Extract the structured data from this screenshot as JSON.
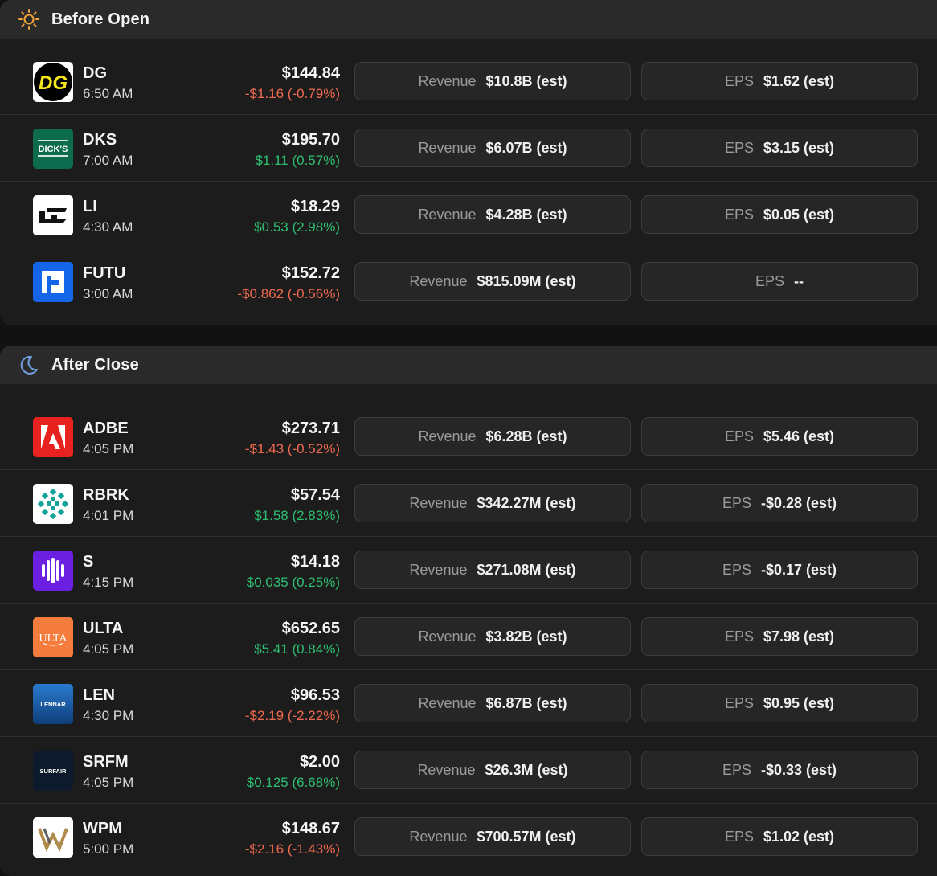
{
  "before_open": {
    "title": "Before Open",
    "icon": "sun-icon",
    "rows": [
      {
        "ticker": "DG",
        "time": "6:50 AM",
        "price": "$144.84",
        "change": "-$1.16 (-0.79%)",
        "direction": "neg",
        "revenue_label": "Revenue",
        "revenue": "$10.8B (est)",
        "eps_label": "EPS",
        "eps": "$1.62 (est)",
        "logo": "DG"
      },
      {
        "ticker": "DKS",
        "time": "7:00 AM",
        "price": "$195.70",
        "change": "$1.11 (0.57%)",
        "direction": "pos",
        "revenue_label": "Revenue",
        "revenue": "$6.07B (est)",
        "eps_label": "EPS",
        "eps": "$3.15 (est)",
        "logo": "DICK'S"
      },
      {
        "ticker": "LI",
        "time": "4:30 AM",
        "price": "$18.29",
        "change": "$0.53 (2.98%)",
        "direction": "pos",
        "revenue_label": "Revenue",
        "revenue": "$4.28B (est)",
        "eps_label": "EPS",
        "eps": "$0.05 (est)",
        "logo": ""
      },
      {
        "ticker": "FUTU",
        "time": "3:00 AM",
        "price": "$152.72",
        "change": "-$0.862 (-0.56%)",
        "direction": "neg",
        "revenue_label": "Revenue",
        "revenue": "$815.09M (est)",
        "eps_label": "EPS",
        "eps": "--",
        "logo": ""
      }
    ]
  },
  "after_close": {
    "title": "After Close",
    "icon": "moon-icon",
    "rows": [
      {
        "ticker": "ADBE",
        "time": "4:05 PM",
        "price": "$273.71",
        "change": "-$1.43 (-0.52%)",
        "direction": "neg",
        "revenue_label": "Revenue",
        "revenue": "$6.28B (est)",
        "eps_label": "EPS",
        "eps": "$5.46 (est)",
        "logo": ""
      },
      {
        "ticker": "RBRK",
        "time": "4:01 PM",
        "price": "$57.54",
        "change": "$1.58 (2.83%)",
        "direction": "pos",
        "revenue_label": "Revenue",
        "revenue": "$342.27M (est)",
        "eps_label": "EPS",
        "eps": "-$0.28 (est)",
        "logo": ""
      },
      {
        "ticker": "S",
        "time": "4:15 PM",
        "price": "$14.18",
        "change": "$0.035 (0.25%)",
        "direction": "pos",
        "revenue_label": "Revenue",
        "revenue": "$271.08M (est)",
        "eps_label": "EPS",
        "eps": "-$0.17 (est)",
        "logo": ""
      },
      {
        "ticker": "ULTA",
        "time": "4:05 PM",
        "price": "$652.65",
        "change": "$5.41 (0.84%)",
        "direction": "pos",
        "revenue_label": "Revenue",
        "revenue": "$3.82B (est)",
        "eps_label": "EPS",
        "eps": "$7.98 (est)",
        "logo": "ULTA"
      },
      {
        "ticker": "LEN",
        "time": "4:30 PM",
        "price": "$96.53",
        "change": "-$2.19 (-2.22%)",
        "direction": "neg",
        "revenue_label": "Revenue",
        "revenue": "$6.87B (est)",
        "eps_label": "EPS",
        "eps": "$0.95 (est)",
        "logo": "LENNAR"
      },
      {
        "ticker": "SRFM",
        "time": "4:05 PM",
        "price": "$2.00",
        "change": "$0.125 (6.68%)",
        "direction": "pos",
        "revenue_label": "Revenue",
        "revenue": "$26.3M (est)",
        "eps_label": "EPS",
        "eps": "-$0.33 (est)",
        "logo": "SURFAIR"
      },
      {
        "ticker": "WPM",
        "time": "5:00 PM",
        "price": "$148.67",
        "change": "-$2.16 (-1.43%)",
        "direction": "neg",
        "revenue_label": "Revenue",
        "revenue": "$700.57M (est)",
        "eps_label": "EPS",
        "eps": "$1.02 (est)",
        "logo": ""
      }
    ]
  },
  "colors": {
    "negative": "#ee6a4f",
    "positive": "#2fbf71",
    "sun": "#f2a33a",
    "moon": "#6f9fe0"
  }
}
